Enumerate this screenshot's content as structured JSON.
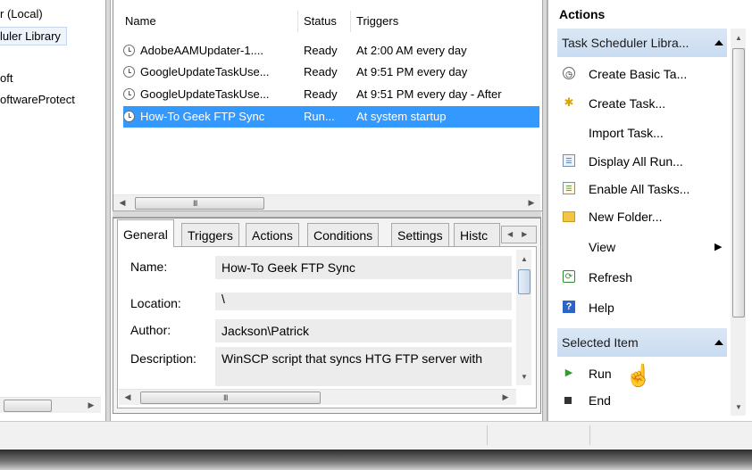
{
  "tree": {
    "items": [
      "r (Local)",
      "luler Library",
      "oft",
      "oftwareProtect"
    ]
  },
  "tasks": {
    "columns": [
      "Name",
      "Status",
      "Triggers"
    ],
    "rows": [
      {
        "name": "AdobeAAMUpdater-1....",
        "status": "Ready",
        "trigger": "At 2:00 AM every day"
      },
      {
        "name": "GoogleUpdateTaskUse...",
        "status": "Ready",
        "trigger": "At 9:51 PM every day"
      },
      {
        "name": "GoogleUpdateTaskUse...",
        "status": "Ready",
        "trigger": "At 9:51 PM every day - After"
      },
      {
        "name": "How-To Geek FTP Sync",
        "status": "Run...",
        "trigger": "At system startup"
      }
    ],
    "scroll_grip": "III"
  },
  "tabs": [
    "General",
    "Triggers",
    "Actions",
    "Conditions",
    "Settings",
    "Histc"
  ],
  "details": {
    "name_label": "Name:",
    "name_value": "How-To Geek FTP Sync",
    "location_label": "Location:",
    "location_value": "\\",
    "author_label": "Author:",
    "author_value": "Jackson\\Patrick",
    "description_label": "Description:",
    "description_value": "WinSCP script that syncs HTG FTP server with"
  },
  "actions": {
    "title": "Actions",
    "section1": "Task Scheduler Libra...",
    "items": [
      {
        "label": "Create Basic Ta...",
        "icon": "wizard-icon"
      },
      {
        "label": "Create Task...",
        "icon": "task-icon"
      },
      {
        "label": "Import Task...",
        "icon": ""
      },
      {
        "label": "Display All Run...",
        "icon": "running-tasks-icon"
      },
      {
        "label": "Enable All Tasks...",
        "icon": "history-icon"
      },
      {
        "label": "New Folder...",
        "icon": "folder-icon"
      },
      {
        "label": "View",
        "icon": ""
      },
      {
        "label": "Refresh",
        "icon": "refresh-icon"
      },
      {
        "label": "Help",
        "icon": "help-icon"
      }
    ],
    "section2": "Selected Item",
    "selected_items": [
      {
        "label": "Run",
        "icon": "run-icon"
      },
      {
        "label": "End",
        "icon": "end-icon"
      }
    ]
  },
  "colors": {
    "selection": "#3399ff",
    "action_header": "#c9dcf1"
  }
}
